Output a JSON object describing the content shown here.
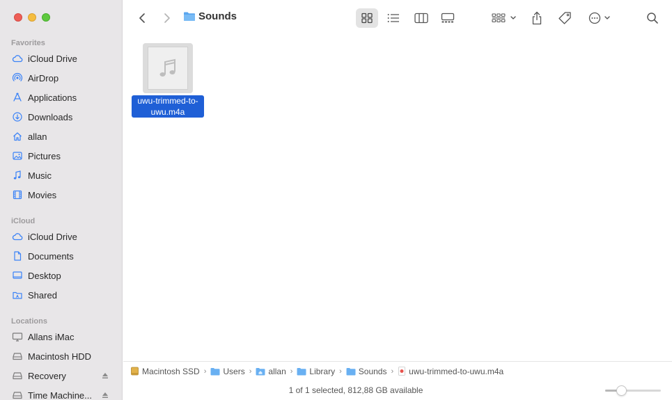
{
  "window": {
    "title": "Sounds"
  },
  "sidebar": {
    "favorites": {
      "heading": "Favorites",
      "items": [
        {
          "label": "iCloud Drive",
          "icon": "cloud-icon"
        },
        {
          "label": "AirDrop",
          "icon": "airdrop-icon"
        },
        {
          "label": "Applications",
          "icon": "applications-icon"
        },
        {
          "label": "Downloads",
          "icon": "downloads-icon"
        },
        {
          "label": "allan",
          "icon": "home-icon"
        },
        {
          "label": "Pictures",
          "icon": "pictures-icon"
        },
        {
          "label": "Music",
          "icon": "music-icon"
        },
        {
          "label": "Movies",
          "icon": "movies-icon"
        }
      ]
    },
    "icloud": {
      "heading": "iCloud",
      "items": [
        {
          "label": "iCloud Drive",
          "icon": "cloud-icon"
        },
        {
          "label": "Documents",
          "icon": "document-icon"
        },
        {
          "label": "Desktop",
          "icon": "desktop-icon"
        },
        {
          "label": "Shared",
          "icon": "shared-folder-icon"
        }
      ]
    },
    "locations": {
      "heading": "Locations",
      "items": [
        {
          "label": "Allans iMac",
          "icon": "computer-icon"
        },
        {
          "label": "Macintosh HDD",
          "icon": "disk-icon"
        },
        {
          "label": "Recovery",
          "icon": "disk-icon",
          "ejectable": true
        },
        {
          "label": "Time Machine...",
          "icon": "disk-icon",
          "ejectable": true
        }
      ]
    }
  },
  "toolbar": {
    "title": "Sounds",
    "active_view": "icon"
  },
  "files": [
    {
      "name": "uwu-trimmed-to-uwu.m4a",
      "name_line1": "uwu-trimmed-to-",
      "name_line2": "uwu.m4a",
      "selected": true,
      "icon": "audio-file-icon"
    }
  ],
  "pathbar": {
    "crumbs": [
      {
        "label": "Macintosh SSD",
        "icon": "disk-icon"
      },
      {
        "label": "Users",
        "icon": "folder-icon"
      },
      {
        "label": "allan",
        "icon": "home-folder-icon"
      },
      {
        "label": "Library",
        "icon": "folder-icon"
      },
      {
        "label": "Sounds",
        "icon": "folder-icon"
      },
      {
        "label": "uwu-trimmed-to-uwu.m4a",
        "icon": "audio-file-icon"
      }
    ]
  },
  "status": {
    "text": "1 of 1 selected, 812,88 GB available",
    "icon_size_fraction": 0.25
  },
  "colors": {
    "accent": "#1f5fd6",
    "sidebar_bg": "#e8e6e8",
    "icon_blue": "#3a82f7"
  }
}
